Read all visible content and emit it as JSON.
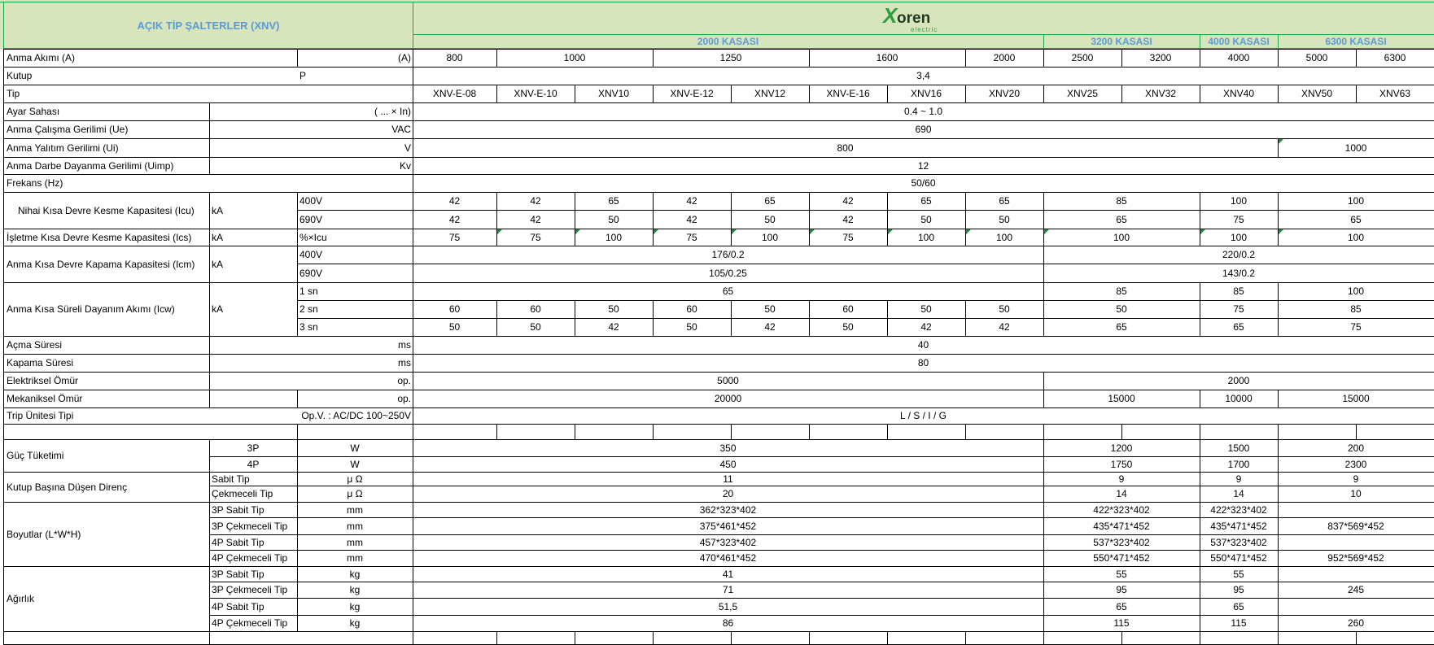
{
  "header": {
    "title": "AÇIK TİP ŞALTERLER (XNV)",
    "logo_text": "Xoren",
    "logo_sub": "electric",
    "groups": [
      "2000 KASASI",
      "3200 KASASI",
      "4000 KASASI",
      "6300 KASASI"
    ]
  },
  "rows": {
    "anma_akimi": {
      "label": "Anma Akımı (A)",
      "unit": "(A)",
      "values": [
        "800",
        "1000",
        "1250",
        "1600",
        "2000",
        "2500",
        "3200",
        "4000",
        "5000",
        "6300"
      ]
    },
    "kutup": {
      "label": "Kutup",
      "unit": "P",
      "value": "3,4"
    },
    "tip": {
      "label": "Tip",
      "values": [
        "XNV-E-08",
        "XNV-E-10",
        "XNV10",
        "XNV-E-12",
        "XNV12",
        "XNV-E-16",
        "XNV16",
        "XNV20",
        "XNV25",
        "XNV32",
        "XNV40",
        "XNV50",
        "XNV63"
      ]
    },
    "ayar": {
      "label": "Ayar Sahası",
      "unit": "( ... × In)",
      "value": "0.4 ~ 1.0"
    },
    "ue": {
      "label": "Anma Çalışma Gerilimi (Ue)",
      "unit": "VAC",
      "value": "690"
    },
    "ui": {
      "label": "Anma Yalıtım Gerilimi (Ui)",
      "unit": "V",
      "value_a": "800",
      "value_b": "1000"
    },
    "uimp": {
      "label": "Anma Darbe Dayanma Gerilimi (Uimp)",
      "unit": "Kv",
      "value": "12"
    },
    "frekans": {
      "label": "Frekans (Hz)",
      "value": "50/60"
    },
    "icu": {
      "label": "Nihai Kısa Devre Kesme Kapasitesi (Icu)",
      "unit": "kA",
      "sub": [
        "400V",
        "690V"
      ],
      "v400": [
        "42",
        "42",
        "65",
        "42",
        "65",
        "42",
        "65",
        "65",
        "85",
        "100",
        "100"
      ],
      "v690": [
        "42",
        "42",
        "50",
        "42",
        "50",
        "42",
        "50",
        "50",
        "65",
        "75",
        "65"
      ]
    },
    "ics": {
      "label": "İşletme Kısa Devre Kesme Kapasitesi (Ics)",
      "unit": "kA",
      "sub": "%×Icu",
      "values": [
        "75",
        "75",
        "100",
        "75",
        "100",
        "75",
        "100",
        "100",
        "100",
        "100",
        "100"
      ]
    },
    "icm": {
      "label": "Anma Kısa Devre Kapama Kapasitesi (Icm)",
      "unit": "kA",
      "sub": [
        "400V",
        "690V"
      ],
      "v400": [
        "176/0.2",
        "220/0.2"
      ],
      "v690": [
        "105/0.25",
        "143/0.2"
      ]
    },
    "icw": {
      "label": "Anma Kısa Süreli Dayanım Akımı (Icw)",
      "unit": "kA",
      "sub": [
        "1 sn",
        "2 sn",
        "3 sn"
      ],
      "s1": [
        "65",
        "85",
        "85",
        "100"
      ],
      "s2": [
        "60",
        "60",
        "50",
        "60",
        "50",
        "60",
        "50",
        "50",
        "50",
        "75",
        "85"
      ],
      "s3": [
        "50",
        "50",
        "42",
        "50",
        "42",
        "50",
        "42",
        "42",
        "65",
        "65",
        "75"
      ]
    },
    "acma": {
      "label": "Açma Süresi",
      "unit": "ms",
      "value": "40"
    },
    "kapama": {
      "label": "Kapama Süresi",
      "unit": "ms",
      "value": "80"
    },
    "elek": {
      "label": "Elektriksel Ömür",
      "unit": "op.",
      "values": [
        "5000",
        "2000"
      ]
    },
    "mek": {
      "label": "Mekaniksel Ömür",
      "unit": "op.",
      "values": [
        "20000",
        "15000",
        "10000",
        "15000"
      ]
    },
    "trip": {
      "label": "Trip Ünitesi Tipi",
      "sub": "Op.V. :  AC/DC 100~250V",
      "value": "L / S / I / G"
    },
    "guc": {
      "label": "Güç Tüketimi",
      "r3": {
        "sub": "3P",
        "unit": "W",
        "values": [
          "350",
          "1200",
          "1500",
          "200"
        ]
      },
      "r4": {
        "sub": "4P",
        "unit": "W",
        "values": [
          "450",
          "1750",
          "1700",
          "2300"
        ]
      }
    },
    "direnc": {
      "label": "Kutup Başına Düşen Direnç",
      "r1": {
        "sub": "Sabit Tip",
        "unit": "μ Ω",
        "values": [
          "11",
          "9",
          "9",
          "9"
        ]
      },
      "r2": {
        "sub": "Çekmeceli Tip",
        "unit": "μ Ω",
        "values": [
          "20",
          "14",
          "14",
          "10"
        ]
      }
    },
    "boyut": {
      "label": "Boyutlar (L*W*H)",
      "r1": {
        "sub": "3P Sabit Tip",
        "unit": "mm",
        "values": [
          "362*323*402",
          "422*323*402",
          "422*323*402",
          ""
        ]
      },
      "r2": {
        "sub": "3P Çekmeceli Tip",
        "unit": "mm",
        "values": [
          "375*461*452",
          "435*471*452",
          "435*471*452",
          "837*569*452"
        ]
      },
      "r3": {
        "sub": "4P Sabit Tip",
        "unit": "mm",
        "values": [
          "457*323*402",
          "537*323*402",
          "537*323*402",
          ""
        ]
      },
      "r4": {
        "sub": "4P Çekmeceli Tip",
        "unit": "mm",
        "values": [
          "470*461*452",
          "550*471*452",
          "550*471*452",
          "952*569*452"
        ]
      }
    },
    "agirlik": {
      "label": "Ağırlık",
      "r1": {
        "sub": "3P Sabit Tip",
        "unit": "kg",
        "values": [
          "41",
          "55",
          "55",
          ""
        ]
      },
      "r2": {
        "sub": "3P Çekmeceli Tip",
        "unit": "kg",
        "values": [
          "71",
          "95",
          "95",
          "245"
        ]
      },
      "r3": {
        "sub": "4P Sabit Tip",
        "unit": "kg",
        "values": [
          "51,5",
          "65",
          "65",
          ""
        ]
      },
      "r4": {
        "sub": "4P Çekmeceli Tip",
        "unit": "kg",
        "values": [
          "86",
          "115",
          "115",
          "260"
        ]
      }
    }
  },
  "colors": {
    "header_bg": "#d8e4bc",
    "header_text": "#5b9bd5",
    "grid": "#000000",
    "accent_green": "#1ea64a"
  }
}
